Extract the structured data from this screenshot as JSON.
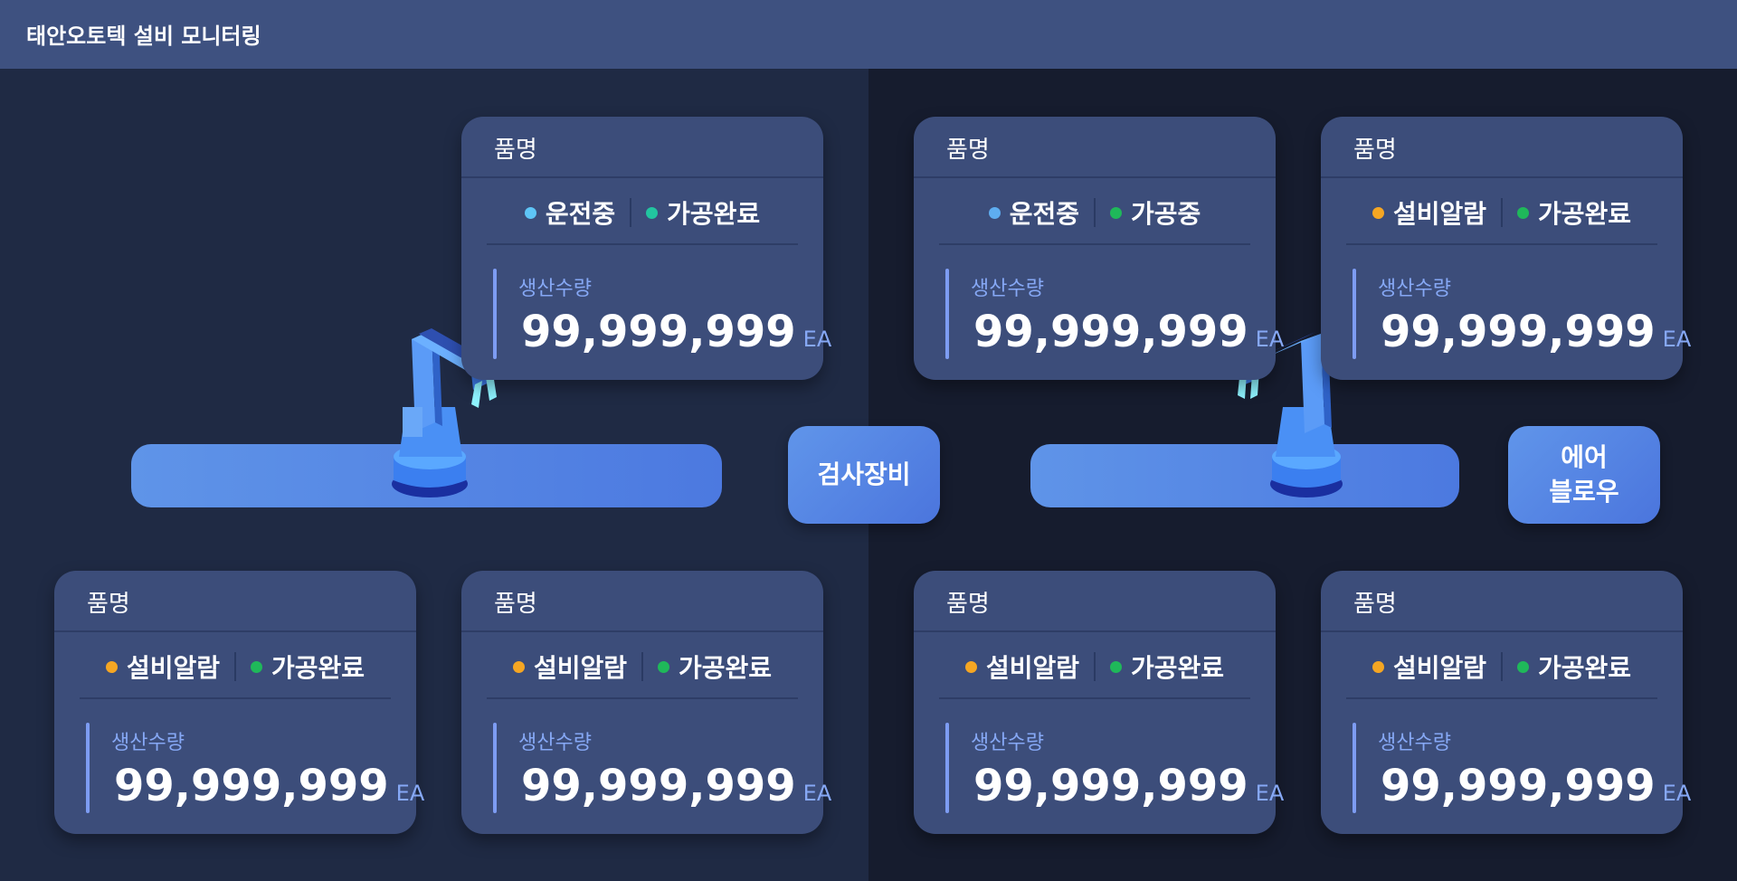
{
  "header": {
    "title": "태안오토텍 설비 모니터링"
  },
  "stations": [
    {
      "id": "inspection",
      "label": "검사장비"
    },
    {
      "id": "air-blow",
      "label": "에어\n블로우"
    }
  ],
  "colors": {
    "running": "#5ec5f7",
    "alarm": "#f5a623",
    "done": "#1fb85a",
    "done_alt": "#22c5a0"
  },
  "cards": [
    {
      "name": "품명",
      "status1": {
        "text": "운전중",
        "color": "#5ec5f7"
      },
      "status2": {
        "text": "가공완료",
        "color": "#22c5a0"
      },
      "label": "생산수량",
      "qty": "99,999,999",
      "unit": "EA"
    },
    {
      "name": "품명",
      "status1": {
        "text": "운전중",
        "color": "#5eadf0"
      },
      "status2": {
        "text": "가공중",
        "color": "#1fb85a"
      },
      "label": "생산수량",
      "qty": "99,999,999",
      "unit": "EA"
    },
    {
      "name": "품명",
      "status1": {
        "text": "설비알람",
        "color": "#f5a623"
      },
      "status2": {
        "text": "가공완료",
        "color": "#1fb85a"
      },
      "label": "생산수량",
      "qty": "99,999,999",
      "unit": "EA"
    },
    {
      "name": "품명",
      "status1": {
        "text": "설비알람",
        "color": "#f5a623"
      },
      "status2": {
        "text": "가공완료",
        "color": "#1fb85a"
      },
      "label": "생산수량",
      "qty": "99,999,999",
      "unit": "EA"
    },
    {
      "name": "품명",
      "status1": {
        "text": "설비알람",
        "color": "#f5a623"
      },
      "status2": {
        "text": "가공완료",
        "color": "#1fb85a"
      },
      "label": "생산수량",
      "qty": "99,999,999",
      "unit": "EA"
    },
    {
      "name": "품명",
      "status1": {
        "text": "설비알람",
        "color": "#f5a623"
      },
      "status2": {
        "text": "가공완료",
        "color": "#1fb85a"
      },
      "label": "생산수량",
      "qty": "99,999,999",
      "unit": "EA"
    },
    {
      "name": "품명",
      "status1": {
        "text": "설비알람",
        "color": "#f5a623"
      },
      "status2": {
        "text": "가공완료",
        "color": "#1fb85a"
      },
      "label": "생산수량",
      "qty": "99,999,999",
      "unit": "EA"
    }
  ]
}
